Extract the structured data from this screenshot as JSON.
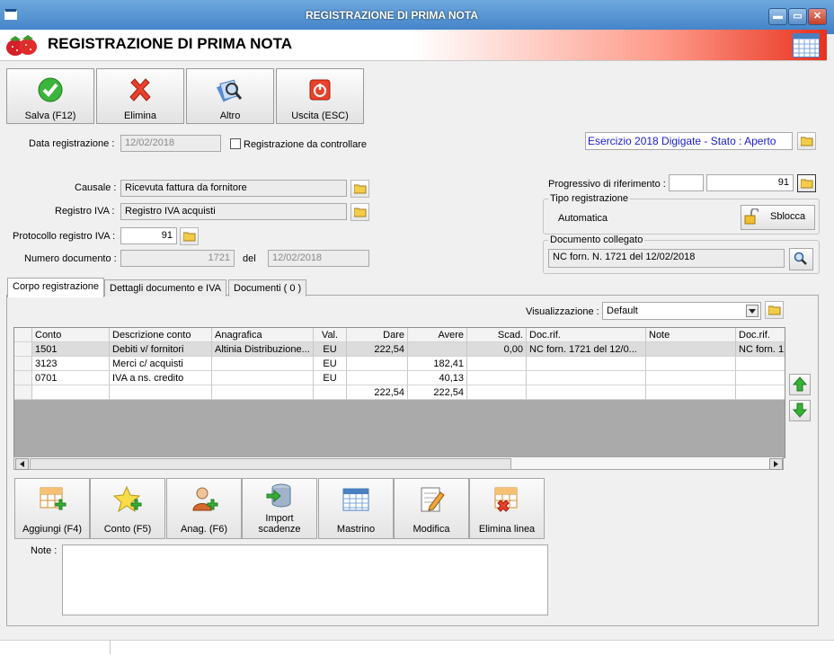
{
  "window": {
    "title": "REGISTRAZIONE DI PRIMA NOTA",
    "minimize": "▬",
    "maximize": "▭",
    "close": "✕"
  },
  "banner": {
    "title": "REGISTRAZIONE DI PRIMA NOTA"
  },
  "toolbar": {
    "save": "Salva (F12)",
    "delete": "Elimina",
    "other": "Altro",
    "exit": "Uscita (ESC)"
  },
  "form": {
    "date_label": "Data registrazione :",
    "date_value": "12/02/2018",
    "check_label": "Registrazione da controllare",
    "esercizio": "Esercizio 2018 Digigate - Stato : Aperto",
    "causale_label": "Causale :",
    "causale_value": "Ricevuta fattura da fornitore",
    "registro_label": "Registro IVA :",
    "registro_value": "Registro IVA acquisti",
    "protocollo_label": "Protocollo registro IVA :",
    "protocollo_value": "91",
    "numdoc_label": "Numero documento :",
    "numdoc_value": "1721",
    "del_label": "del",
    "del_value": "12/02/2018",
    "progressivo_label": "Progressivo di riferimento :",
    "progressivo_value": "91",
    "tipo_title": "Tipo registrazione",
    "tipo_value": "Automatica",
    "sblocca": "Sblocca",
    "doc_title": "Documento collegato",
    "doc_value": "NC forn. N. 1721 del 12/02/2018"
  },
  "tabs": [
    "Corpo registrazione",
    "Dettagli documento e IVA",
    "Documenti ( 0 )"
  ],
  "view": {
    "label": "Visualizzazione :",
    "value": "Default"
  },
  "grid": {
    "headers": [
      "Conto",
      "Descrizione conto",
      "Anagrafica",
      "Val.",
      "Dare",
      "Avere",
      "Scad.",
      "Doc.rif.",
      "Note",
      "Doc.rif."
    ],
    "rows": [
      [
        "1501",
        "Debiti v/ fornitori",
        "Altinia Distribuzione...",
        "EU",
        "222,54",
        "",
        "0,00",
        "NC forn. 1721 del 12/0...",
        "",
        "NC forn. 1"
      ],
      [
        "3123",
        "Merci c/ acquisti",
        "",
        "EU",
        "",
        "182,41",
        "",
        "",
        "",
        ""
      ],
      [
        "0701",
        "IVA a ns. credito",
        "",
        "EU",
        "",
        "40,13",
        "",
        "",
        "",
        ""
      ],
      [
        "",
        "",
        "",
        "",
        "222,54",
        "222,54",
        "",
        "",
        "",
        ""
      ]
    ]
  },
  "bottom_buttons": {
    "add": "Aggiungi (F4)",
    "conto": "Conto (F5)",
    "anag": "Anag. (F6)",
    "import1": "Import",
    "import2": "scadenze",
    "mastrino": "Mastrino",
    "modifica": "Modifica",
    "elimina": "Elimina linea"
  },
  "note_label": "Note :",
  "icons": [
    "app-icon",
    "strawberry-icon",
    "calendar-icon",
    "check-icon",
    "x-icon",
    "search-docs-icon",
    "exit-icon",
    "folder-icon",
    "padlock-icon",
    "magnifier-icon",
    "arrow-up-icon",
    "arrow-down-icon",
    "grid-add-icon",
    "star-add-icon",
    "person-add-icon",
    "database-import-icon",
    "edit-icon",
    "grid-delete-icon"
  ]
}
